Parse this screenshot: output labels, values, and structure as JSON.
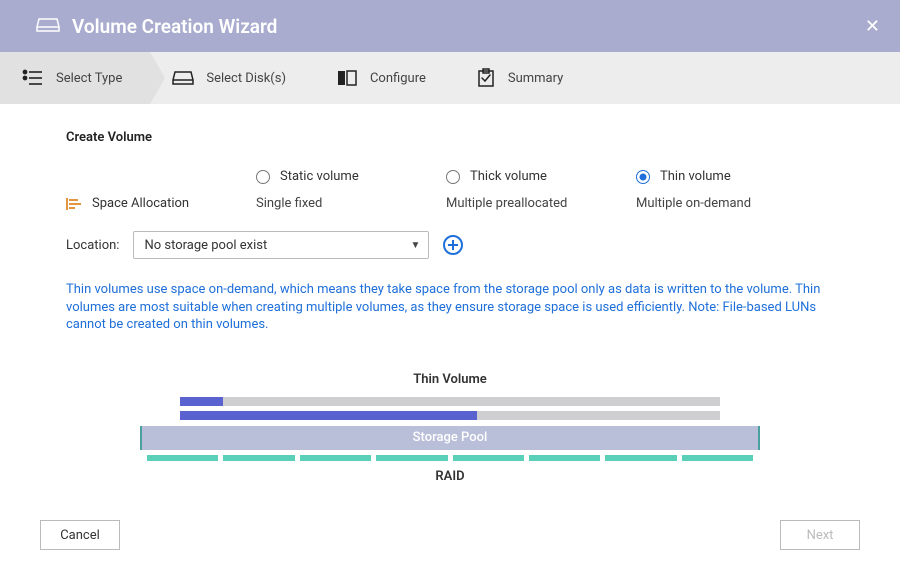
{
  "window": {
    "title": "Volume Creation Wizard"
  },
  "steps": [
    {
      "label": "Select Type"
    },
    {
      "label": "Select Disk(s)"
    },
    {
      "label": "Configure"
    },
    {
      "label": "Summary"
    }
  ],
  "section": {
    "title": "Create Volume"
  },
  "types": {
    "static": {
      "label": "Static volume",
      "alloc": "Single fixed"
    },
    "thick": {
      "label": "Thick volume",
      "alloc": "Multiple preallocated"
    },
    "thin": {
      "label": "Thin volume",
      "alloc": "Multiple on-demand",
      "selected": true
    }
  },
  "space_allocation_label": "Space Allocation",
  "location": {
    "label": "Location:",
    "selected": "No storage pool exist"
  },
  "description": "Thin volumes use space on-demand, which means they take space from the storage pool only as data is written to the volume. Thin volumes are most suitable when creating multiple volumes, as they ensure storage space is used efficiently. Note: File-based LUNs cannot be created on thin volumes.",
  "diagram": {
    "top_label": "Thin Volume",
    "pool_label": "Storage Pool",
    "bottom_label": "RAID",
    "bar1_fill_pct": 8,
    "bar2_fill_pct": 55,
    "raid_segments": 8
  },
  "buttons": {
    "cancel": "Cancel",
    "next": "Next"
  }
}
